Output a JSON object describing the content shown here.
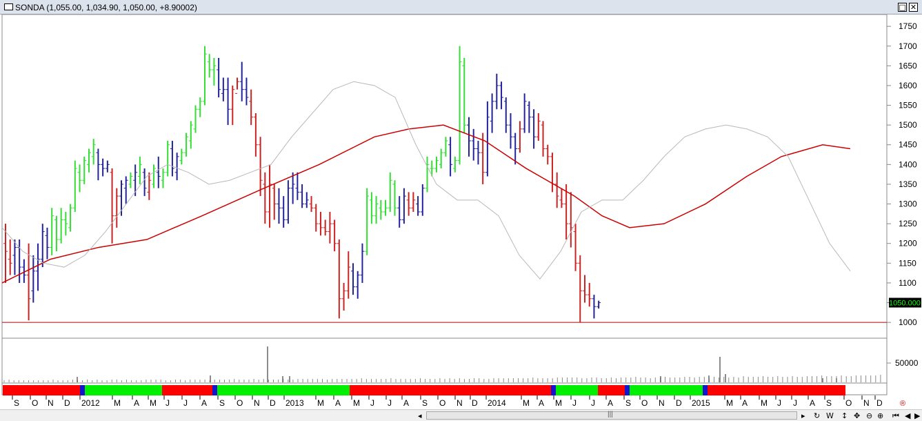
{
  "window": {
    "title": "SONDA (1,055.00, 1,034.90, 1,050.00, +8.90002)",
    "restore_glyph": "□",
    "close_glyph": "✕"
  },
  "price_axis": {
    "labels": [
      "1750",
      "1700",
      "1650",
      "1600",
      "1550",
      "1500",
      "1450",
      "1400",
      "1350",
      "1300",
      "1250",
      "1200",
      "1150",
      "1100",
      "1050",
      "1000"
    ],
    "current_value": "1050.000",
    "current_value_color": "#00ff00",
    "current_value_bg": "#000000"
  },
  "volume_axis": {
    "label": "50000"
  },
  "timeline": {
    "months": [
      "S",
      "O",
      "N",
      "D",
      "2012",
      "M",
      "A",
      "M",
      "J",
      "J",
      "A",
      "S",
      "O",
      "N",
      "D",
      "2013",
      "M",
      "A",
      "M",
      "J",
      "J",
      "A",
      "S",
      "O",
      "N",
      "D",
      "2014",
      "M",
      "A",
      "M",
      "J",
      "J",
      "A",
      "S",
      "O",
      "N",
      "D",
      "2015",
      "M",
      "A",
      "M",
      "J",
      "J",
      "A",
      "S",
      "O",
      "N",
      "D"
    ],
    "band_colors": {
      "bear": "#ff0000",
      "bull": "#00ee00",
      "neutral": "#1515d0"
    }
  },
  "colors": {
    "bull_bar": "#33dd33",
    "bear_bar": "#cc2222",
    "neutral_bar": "#22229a",
    "long_ma": "#cc0000",
    "short_ma": "#b8b8b8",
    "support_line": "#aa0000"
  },
  "chart_data": {
    "type": "ohlc",
    "ylim": [
      960,
      1780
    ],
    "support_level": 1000,
    "bars": [
      [
        1200,
        1250,
        1100,
        1180,
        "b"
      ],
      [
        1160,
        1210,
        1120,
        1150,
        "b"
      ],
      [
        1170,
        1210,
        1120,
        1190,
        "n"
      ],
      [
        1190,
        1210,
        1100,
        1140,
        "n"
      ],
      [
        1140,
        1160,
        1100,
        1120,
        "n"
      ],
      [
        1120,
        1200,
        1005,
        1060,
        "b"
      ],
      [
        1080,
        1170,
        1050,
        1130,
        "n"
      ],
      [
        1130,
        1200,
        1080,
        1160,
        "n"
      ],
      [
        1160,
        1250,
        1140,
        1230,
        "n"
      ],
      [
        1220,
        1240,
        1160,
        1190,
        "n"
      ],
      [
        1190,
        1290,
        1170,
        1270,
        "g"
      ],
      [
        1260,
        1270,
        1180,
        1210,
        "g"
      ],
      [
        1210,
        1290,
        1200,
        1260,
        "g"
      ],
      [
        1260,
        1280,
        1220,
        1250,
        "g"
      ],
      [
        1240,
        1300,
        1230,
        1290,
        "g"
      ],
      [
        1290,
        1410,
        1280,
        1390,
        "g"
      ],
      [
        1380,
        1400,
        1330,
        1360,
        "g"
      ],
      [
        1360,
        1420,
        1350,
        1410,
        "g"
      ],
      [
        1400,
        1440,
        1380,
        1430,
        "g"
      ],
      [
        1420,
        1465,
        1400,
        1450,
        "g"
      ],
      [
        1430,
        1440,
        1360,
        1400,
        "n"
      ],
      [
        1400,
        1415,
        1370,
        1390,
        "n"
      ],
      [
        1390,
        1410,
        1380,
        1400,
        "n"
      ],
      [
        1380,
        1390,
        1200,
        1270,
        "b"
      ],
      [
        1270,
        1340,
        1240,
        1320,
        "b"
      ],
      [
        1320,
        1360,
        1270,
        1350,
        "n"
      ],
      [
        1340,
        1370,
        1300,
        1360,
        "n"
      ],
      [
        1350,
        1380,
        1340,
        1370,
        "g"
      ],
      [
        1360,
        1400,
        1320,
        1380,
        "n"
      ],
      [
        1370,
        1420,
        1350,
        1400,
        "g"
      ],
      [
        1380,
        1390,
        1320,
        1340,
        "n"
      ],
      [
        1330,
        1380,
        1310,
        1360,
        "b"
      ],
      [
        1350,
        1400,
        1340,
        1390,
        "g"
      ],
      [
        1380,
        1420,
        1340,
        1370,
        "n"
      ],
      [
        1360,
        1390,
        1340,
        1380,
        "g"
      ],
      [
        1380,
        1460,
        1370,
        1450,
        "g"
      ],
      [
        1440,
        1460,
        1370,
        1390,
        "n"
      ],
      [
        1380,
        1430,
        1360,
        1420,
        "n"
      ],
      [
        1410,
        1440,
        1400,
        1430,
        "g"
      ],
      [
        1430,
        1480,
        1420,
        1470,
        "g"
      ],
      [
        1460,
        1510,
        1440,
        1500,
        "g"
      ],
      [
        1490,
        1550,
        1480,
        1540,
        "g"
      ],
      [
        1540,
        1570,
        1520,
        1560,
        "g"
      ],
      [
        1560,
        1700,
        1550,
        1680,
        "g"
      ],
      [
        1660,
        1680,
        1620,
        1640,
        "g"
      ],
      [
        1640,
        1670,
        1600,
        1650,
        "g"
      ],
      [
        1640,
        1670,
        1570,
        1590,
        "n"
      ],
      [
        1580,
        1620,
        1560,
        1590,
        "n"
      ],
      [
        1590,
        1620,
        1500,
        1540,
        "n"
      ],
      [
        1540,
        1600,
        1500,
        1590,
        "b"
      ],
      [
        1580,
        1620,
        1590,
        1610,
        "b"
      ],
      [
        1610,
        1660,
        1560,
        1590,
        "n"
      ],
      [
        1590,
        1620,
        1550,
        1570,
        "n"
      ],
      [
        1560,
        1590,
        1500,
        1520,
        "b"
      ],
      [
        1520,
        1530,
        1420,
        1450,
        "b"
      ],
      [
        1450,
        1470,
        1320,
        1360,
        "b"
      ],
      [
        1350,
        1380,
        1250,
        1280,
        "b"
      ],
      [
        1280,
        1400,
        1240,
        1350,
        "b"
      ],
      [
        1340,
        1350,
        1260,
        1300,
        "b"
      ],
      [
        1300,
        1340,
        1250,
        1290,
        "n"
      ],
      [
        1290,
        1320,
        1240,
        1260,
        "n"
      ],
      [
        1260,
        1360,
        1250,
        1340,
        "n"
      ],
      [
        1340,
        1380,
        1300,
        1350,
        "n"
      ],
      [
        1340,
        1380,
        1310,
        1330,
        "n"
      ],
      [
        1330,
        1350,
        1290,
        1300,
        "n"
      ],
      [
        1300,
        1330,
        1290,
        1310,
        "n"
      ],
      [
        1300,
        1320,
        1280,
        1290,
        "b"
      ],
      [
        1290,
        1300,
        1230,
        1250,
        "b"
      ],
      [
        1250,
        1280,
        1220,
        1240,
        "b"
      ],
      [
        1240,
        1260,
        1220,
        1230,
        "b"
      ],
      [
        1230,
        1280,
        1200,
        1250,
        "b"
      ],
      [
        1250,
        1260,
        1180,
        1200,
        "b"
      ],
      [
        1200,
        1210,
        1010,
        1060,
        "b"
      ],
      [
        1060,
        1100,
        1030,
        1080,
        "b"
      ],
      [
        1080,
        1180,
        1060,
        1140,
        "b"
      ],
      [
        1130,
        1150,
        1070,
        1090,
        "n"
      ],
      [
        1090,
        1130,
        1060,
        1120,
        "n"
      ],
      [
        1120,
        1200,
        1100,
        1180,
        "n"
      ],
      [
        1180,
        1340,
        1170,
        1320,
        "g"
      ],
      [
        1310,
        1330,
        1250,
        1270,
        "g"
      ],
      [
        1270,
        1320,
        1250,
        1300,
        "g"
      ],
      [
        1290,
        1310,
        1260,
        1280,
        "g"
      ],
      [
        1280,
        1310,
        1270,
        1290,
        "g"
      ],
      [
        1290,
        1380,
        1280,
        1360,
        "g"
      ],
      [
        1350,
        1360,
        1270,
        1290,
        "g"
      ],
      [
        1290,
        1320,
        1240,
        1260,
        "n"
      ],
      [
        1260,
        1340,
        1250,
        1320,
        "n"
      ],
      [
        1310,
        1330,
        1270,
        1290,
        "b"
      ],
      [
        1290,
        1330,
        1280,
        1310,
        "b"
      ],
      [
        1300,
        1320,
        1270,
        1280,
        "n"
      ],
      [
        1280,
        1350,
        1270,
        1340,
        "n"
      ],
      [
        1340,
        1420,
        1330,
        1400,
        "g"
      ],
      [
        1390,
        1410,
        1370,
        1390,
        "g"
      ],
      [
        1390,
        1420,
        1380,
        1410,
        "g"
      ],
      [
        1400,
        1440,
        1390,
        1430,
        "g"
      ],
      [
        1430,
        1470,
        1420,
        1460,
        "g"
      ],
      [
        1450,
        1470,
        1370,
        1400,
        "n"
      ],
      [
        1390,
        1420,
        1380,
        1410,
        "g"
      ],
      [
        1410,
        1700,
        1400,
        1660,
        "g"
      ],
      [
        1650,
        1670,
        1480,
        1500,
        "g"
      ],
      [
        1500,
        1520,
        1420,
        1460,
        "n"
      ],
      [
        1460,
        1490,
        1410,
        1440,
        "n"
      ],
      [
        1440,
        1460,
        1400,
        1430,
        "n"
      ],
      [
        1430,
        1480,
        1350,
        1380,
        "b"
      ],
      [
        1380,
        1560,
        1370,
        1520,
        "n"
      ],
      [
        1510,
        1580,
        1480,
        1560,
        "n"
      ],
      [
        1560,
        1630,
        1540,
        1600,
        "n"
      ],
      [
        1600,
        1610,
        1540,
        1570,
        "n"
      ],
      [
        1560,
        1570,
        1480,
        1500,
        "n"
      ],
      [
        1500,
        1530,
        1440,
        1470,
        "n"
      ],
      [
        1470,
        1480,
        1400,
        1440,
        "n"
      ],
      [
        1440,
        1510,
        1430,
        1490,
        "b"
      ],
      [
        1490,
        1580,
        1480,
        1560,
        "n"
      ],
      [
        1550,
        1560,
        1480,
        1520,
        "n"
      ],
      [
        1520,
        1540,
        1440,
        1470,
        "n"
      ],
      [
        1470,
        1530,
        1460,
        1510,
        "b"
      ],
      [
        1500,
        1510,
        1420,
        1440,
        "b"
      ],
      [
        1440,
        1450,
        1400,
        1420,
        "b"
      ],
      [
        1420,
        1430,
        1330,
        1350,
        "b"
      ],
      [
        1350,
        1380,
        1290,
        1320,
        "b"
      ],
      [
        1310,
        1340,
        1290,
        1300,
        "b"
      ],
      [
        1300,
        1350,
        1210,
        1250,
        "b"
      ],
      [
        1250,
        1330,
        1190,
        1240,
        "b"
      ],
      [
        1230,
        1250,
        1130,
        1150,
        "b"
      ],
      [
        1150,
        1170,
        1000,
        1080,
        "b"
      ],
      [
        1080,
        1120,
        1050,
        1070,
        "b"
      ],
      [
        1070,
        1100,
        1040,
        1060,
        "b"
      ],
      [
        1060,
        1070,
        1010,
        1040,
        "n"
      ],
      [
        1040,
        1055,
        1035,
        1050,
        "n"
      ]
    ],
    "long_ma": [
      [
        0,
        1100
      ],
      [
        70,
        1160
      ],
      [
        140,
        1190
      ],
      [
        210,
        1210
      ],
      [
        290,
        1270
      ],
      [
        380,
        1340
      ],
      [
        460,
        1400
      ],
      [
        540,
        1470
      ],
      [
        590,
        1490
      ],
      [
        640,
        1500
      ],
      [
        700,
        1460
      ],
      [
        760,
        1390
      ],
      [
        830,
        1320
      ],
      [
        870,
        1270
      ],
      [
        910,
        1240
      ],
      [
        960,
        1250
      ],
      [
        1020,
        1300
      ],
      [
        1080,
        1370
      ],
      [
        1130,
        1420
      ],
      [
        1190,
        1450
      ],
      [
        1230,
        1440
      ]
    ],
    "short_ma": [
      [
        0,
        1240
      ],
      [
        30,
        1180
      ],
      [
        60,
        1150
      ],
      [
        90,
        1140
      ],
      [
        120,
        1170
      ],
      [
        150,
        1230
      ],
      [
        180,
        1300
      ],
      [
        210,
        1370
      ],
      [
        240,
        1400
      ],
      [
        270,
        1380
      ],
      [
        300,
        1350
      ],
      [
        330,
        1360
      ],
      [
        360,
        1380
      ],
      [
        390,
        1400
      ],
      [
        420,
        1470
      ],
      [
        450,
        1530
      ],
      [
        480,
        1590
      ],
      [
        510,
        1610
      ],
      [
        540,
        1600
      ],
      [
        570,
        1570
      ],
      [
        600,
        1450
      ],
      [
        630,
        1350
      ],
      [
        660,
        1310
      ],
      [
        690,
        1310
      ],
      [
        720,
        1270
      ],
      [
        750,
        1170
      ],
      [
        780,
        1110
      ],
      [
        810,
        1180
      ],
      [
        840,
        1280
      ],
      [
        870,
        1310
      ],
      [
        900,
        1310
      ],
      [
        930,
        1360
      ],
      [
        960,
        1420
      ],
      [
        990,
        1470
      ],
      [
        1020,
        1490
      ],
      [
        1050,
        1500
      ],
      [
        1080,
        1490
      ],
      [
        1110,
        1470
      ],
      [
        1140,
        1420
      ],
      [
        1170,
        1310
      ],
      [
        1200,
        1200
      ],
      [
        1230,
        1130
      ]
    ],
    "volume": [
      3,
      4,
      3,
      3,
      3,
      3,
      3,
      3,
      3,
      3,
      4,
      3,
      3,
      3,
      4,
      3,
      3,
      4,
      3,
      4,
      3,
      3,
      4,
      4,
      3,
      4,
      3,
      3,
      3,
      4,
      4,
      4,
      4,
      3,
      3,
      4,
      4,
      3,
      4,
      4,
      4,
      4,
      3,
      4,
      4,
      4,
      4,
      5,
      4,
      4,
      4,
      5,
      4,
      5,
      4,
      4,
      4,
      5,
      4,
      4,
      5,
      5,
      5,
      5,
      5,
      5,
      4,
      5,
      5,
      5,
      5,
      5,
      5,
      6,
      5,
      5,
      5,
      5,
      5,
      6,
      5,
      5,
      5,
      5,
      5,
      6,
      5,
      5,
      5,
      6,
      5,
      6,
      5,
      6,
      5,
      5,
      6,
      6,
      5,
      5,
      6,
      6,
      6,
      6,
      6,
      6,
      6,
      6,
      7,
      6,
      6,
      6,
      6,
      7,
      7,
      7,
      7,
      7,
      6,
      6,
      7,
      7,
      6,
      6,
      7,
      6,
      7,
      7,
      7,
      8,
      7,
      7,
      6,
      7,
      7,
      8,
      7,
      7,
      7,
      8,
      8,
      7,
      8,
      8,
      7,
      8,
      7,
      8,
      7,
      8,
      7,
      9,
      8,
      8,
      8,
      9,
      8,
      8,
      9,
      8,
      8,
      9,
      8,
      8,
      9,
      9,
      9,
      10,
      9,
      9,
      9,
      10,
      9,
      9,
      10,
      10,
      10,
      10,
      10,
      11
    ],
    "volume_spikes": [
      [
        388,
        52
      ],
      [
        1044,
        37
      ],
      [
        1052,
        12
      ],
      [
        112,
        8
      ],
      [
        305,
        10
      ],
      [
        410,
        9
      ],
      [
        420,
        9
      ],
      [
        958,
        9
      ],
      [
        1028,
        10
      ],
      [
        1193,
        6
      ],
      [
        1213,
        6
      ]
    ]
  }
}
